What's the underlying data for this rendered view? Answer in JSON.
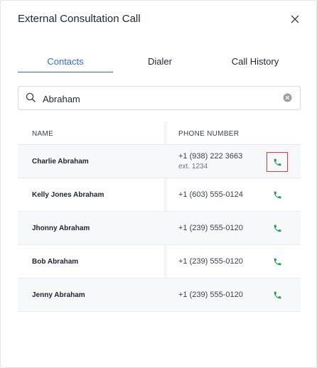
{
  "dialog": {
    "title": "External Consultation Call",
    "close_icon": "close-icon"
  },
  "tabs": [
    {
      "label": "Contacts",
      "active": true
    },
    {
      "label": "Dialer",
      "active": false
    },
    {
      "label": "Call History",
      "active": false
    }
  ],
  "search": {
    "value": "Abraham",
    "icon": "search-icon",
    "clear_icon": "clear-icon"
  },
  "table": {
    "headers": {
      "name": "NAME",
      "phone": "PHONE NUMBER"
    },
    "rows": [
      {
        "name": "Charlie Abraham",
        "phone": "+1 (938) 222 3663",
        "ext": "ext. 1234",
        "highlighted": true
      },
      {
        "name": "Kelly Jones Abraham",
        "phone": "+1 (603) 555-0124",
        "ext": "",
        "highlighted": false
      },
      {
        "name": "Jhonny Abraham",
        "phone": "+1 (239) 555-0120",
        "ext": "",
        "highlighted": false
      },
      {
        "name": "Bob Abraham",
        "phone": "+1 (239) 555-0120",
        "ext": "",
        "highlighted": false
      },
      {
        "name": "Jenny Abraham",
        "phone": "+1 (239) 555-0120",
        "ext": "",
        "highlighted": false
      }
    ]
  },
  "colors": {
    "accent": "#2f6bd6",
    "call_green": "#1f9d4c",
    "highlight_red": "#e03a3a"
  }
}
